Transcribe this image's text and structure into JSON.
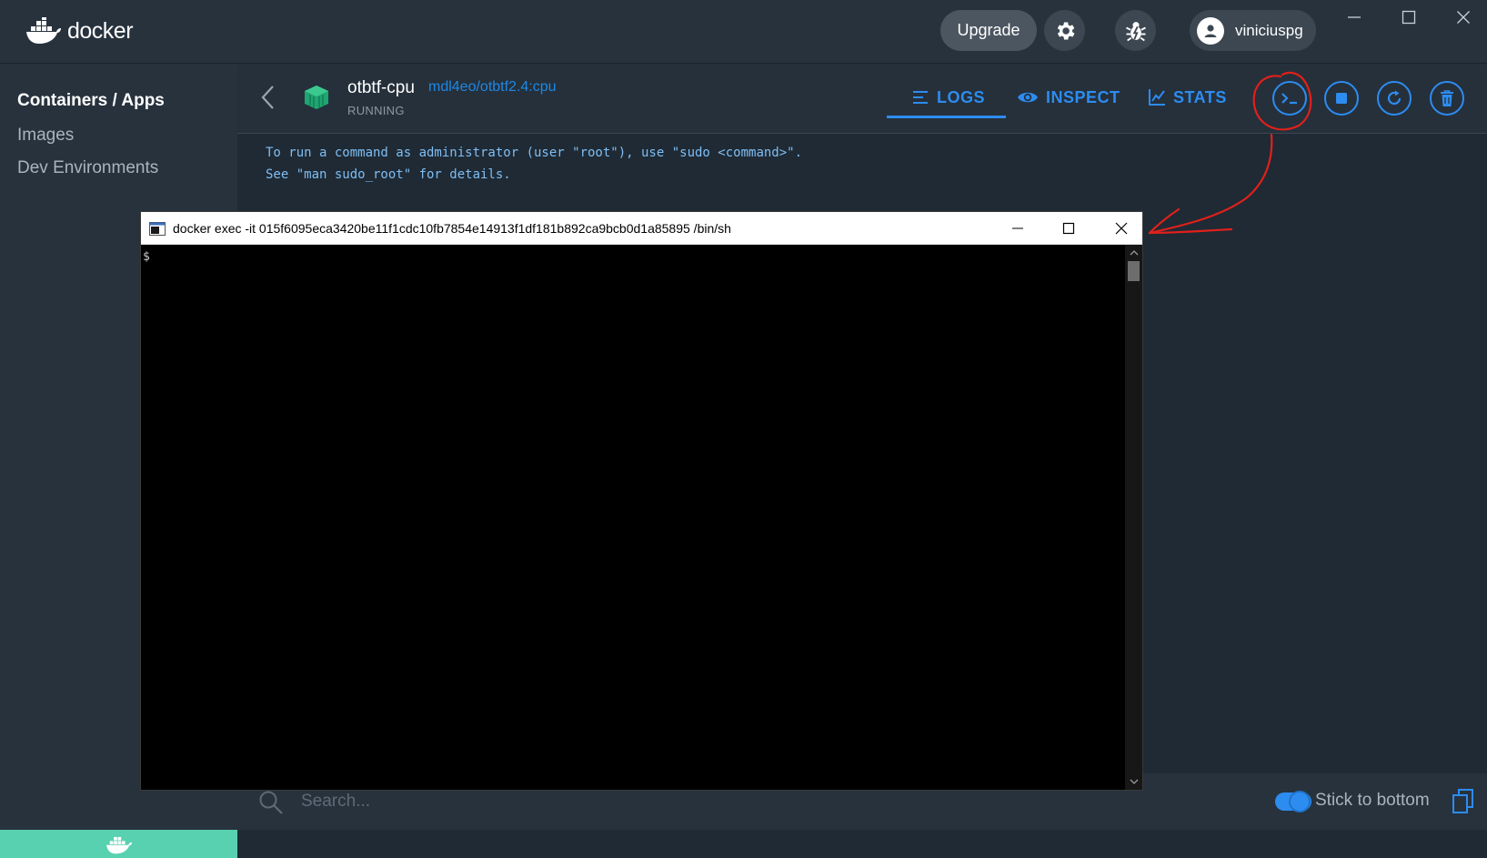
{
  "app": {
    "logo_text": "docker",
    "upgrade_label": "Upgrade",
    "username": "viniciuspg",
    "icons": [
      "settings-gear-icon",
      "bug-icon",
      "user-avatar-icon",
      "minimize-icon",
      "maximize-icon",
      "close-icon"
    ]
  },
  "sidebar": {
    "items": [
      {
        "label": "Containers / Apps",
        "active": true
      },
      {
        "label": "Images",
        "active": false
      },
      {
        "label": "Dev Environments",
        "active": false
      }
    ]
  },
  "container": {
    "name": "otbtf-cpu",
    "image": "mdl4eo/otbtf2.4:cpu",
    "status": "RUNNING",
    "tabs": [
      {
        "label": "LOGS",
        "icon": "list-icon",
        "active": true
      },
      {
        "label": "INSPECT",
        "icon": "eye-icon",
        "active": false
      },
      {
        "label": "STATS",
        "icon": "chart-icon",
        "active": false
      }
    ],
    "actions": [
      "cli-icon",
      "stop-icon",
      "restart-icon",
      "delete-icon"
    ]
  },
  "logs": {
    "lines": [
      "To run a command as administrator (user \"root\"), use \"sudo <command>\".",
      "See \"man sudo_root\" for details."
    ]
  },
  "search": {
    "placeholder": "Search...",
    "stick_label": "Stick to bottom",
    "stick_enabled": true
  },
  "terminal": {
    "title": "docker  exec -it 015f6095eca3420be11f1cdc10fb7854e14913f1df181b892ca9bcb0d1a85895 /bin/sh",
    "prompt": "$"
  },
  "colors": {
    "accent": "#2d8cf0",
    "status_green": "#1ea672",
    "annotation_red": "#e0201b",
    "footer_teal": "#58d1b0"
  }
}
